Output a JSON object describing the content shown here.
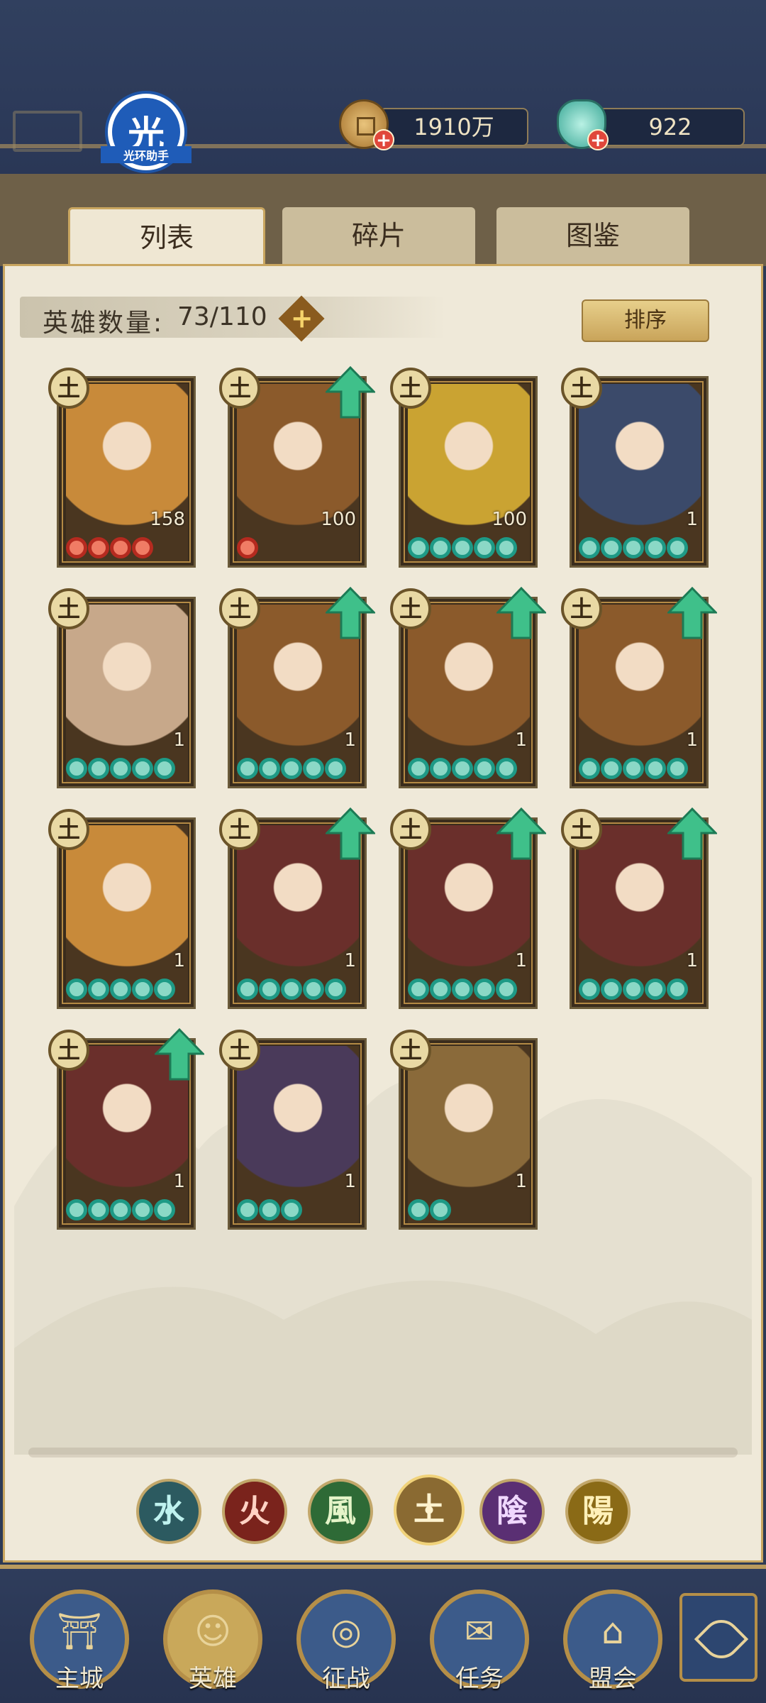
{
  "header": {
    "logo_char": "光",
    "logo_text": "光环助手",
    "coins": "1910万",
    "jade": "922"
  },
  "tabs": [
    {
      "label": "列表",
      "active": true
    },
    {
      "label": "碎片",
      "active": false
    },
    {
      "label": "图鉴",
      "active": false
    }
  ],
  "hero_count": {
    "label": "英雄数量:",
    "value": "73/110",
    "plus": "+"
  },
  "sort_button": "排序",
  "element_symbol": "土",
  "heroes": [
    {
      "level": "158",
      "stars": 4,
      "star_color": "red",
      "upgrade": false
    },
    {
      "level": "100",
      "stars": 1,
      "star_color": "red",
      "upgrade": true
    },
    {
      "level": "100",
      "stars": 5,
      "star_color": "green",
      "upgrade": false
    },
    {
      "level": "1",
      "stars": 5,
      "star_color": "green",
      "upgrade": false
    },
    {
      "level": "1",
      "stars": 5,
      "star_color": "green",
      "upgrade": false
    },
    {
      "level": "1",
      "stars": 5,
      "star_color": "green",
      "upgrade": true
    },
    {
      "level": "1",
      "stars": 5,
      "star_color": "green",
      "upgrade": true
    },
    {
      "level": "1",
      "stars": 5,
      "star_color": "green",
      "upgrade": true
    },
    {
      "level": "1",
      "stars": 5,
      "star_color": "green",
      "upgrade": false
    },
    {
      "level": "1",
      "stars": 5,
      "star_color": "green",
      "upgrade": true
    },
    {
      "level": "1",
      "stars": 5,
      "star_color": "green",
      "upgrade": true
    },
    {
      "level": "1",
      "stars": 5,
      "star_color": "green",
      "upgrade": true
    },
    {
      "level": "1",
      "stars": 5,
      "star_color": "green",
      "upgrade": true
    },
    {
      "level": "1",
      "stars": 3,
      "star_color": "green",
      "upgrade": false
    },
    {
      "level": "1",
      "stars": 2,
      "star_color": "green",
      "upgrade": false
    }
  ],
  "elements": [
    {
      "glyph": "水",
      "color": "#2c5a60",
      "text": "#bff2ef"
    },
    {
      "glyph": "火",
      "color": "#7a231c",
      "text": "#ffd2c4"
    },
    {
      "glyph": "風",
      "color": "#2e6a36",
      "text": "#e4f4c8"
    },
    {
      "glyph": "土",
      "color": "#8a6a32",
      "text": "#fff3cf"
    },
    {
      "glyph": "陰",
      "color": "#5a2f73",
      "text": "#f0d8ff"
    },
    {
      "glyph": "陽",
      "color": "#8a6a16",
      "text": "#fff0b8"
    }
  ],
  "bottom_nav": [
    {
      "label": "主城",
      "icon": "city-gate-icon"
    },
    {
      "label": "英雄",
      "icon": "hero-portrait-icon"
    },
    {
      "label": "征战",
      "icon": "battle-icon"
    },
    {
      "label": "任务",
      "icon": "scroll-task-icon"
    },
    {
      "label": "盟会",
      "icon": "alliance-icon"
    }
  ]
}
